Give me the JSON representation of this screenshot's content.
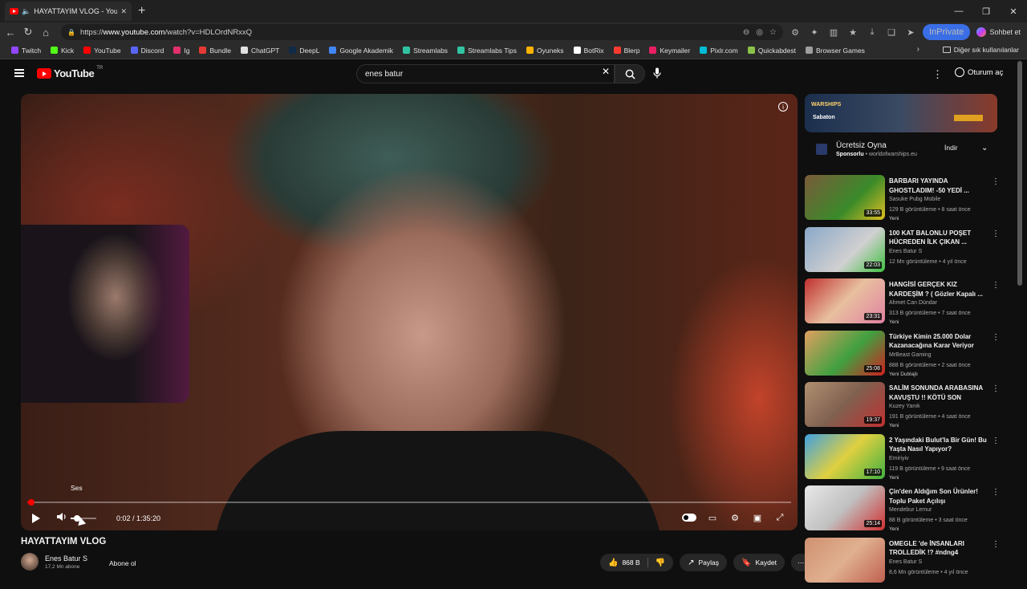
{
  "browser": {
    "tab_title": "HAYATTAYIM VLOG - YouTube",
    "tab_close": "✕",
    "new_tab": "+",
    "url_prefix": "https://",
    "url_host": "www.youtube.com",
    "url_path": "/watch?v=HDLOrdNRxxQ",
    "inprivate": "InPrivate",
    "sohbet": "Sohbet et",
    "window_controls": [
      "—",
      "❐",
      "✕"
    ]
  },
  "bookmarks": {
    "items": [
      {
        "label": "Twitch",
        "color": "#9146ff"
      },
      {
        "label": "Kick",
        "color": "#53fc18"
      },
      {
        "label": "YouTube",
        "color": "#ff0000"
      },
      {
        "label": "Discord",
        "color": "#5865f2"
      },
      {
        "label": "Ig",
        "color": "#e1306c"
      },
      {
        "label": "Bundle",
        "color": "#e53935"
      },
      {
        "label": "ChatGPT",
        "color": "#e0e0e0"
      },
      {
        "label": "DeepL",
        "color": "#0f2b46"
      },
      {
        "label": "Google Akademik",
        "color": "#4285f4"
      },
      {
        "label": "Streamlabs",
        "color": "#31c3a2"
      },
      {
        "label": "Streamlabs Tips",
        "color": "#31c3a2"
      },
      {
        "label": "Oyuneks",
        "color": "#ffb300"
      },
      {
        "label": "BotRix",
        "color": "#ffffff"
      },
      {
        "label": "Blerp",
        "color": "#ff3b30"
      },
      {
        "label": "Keymailer",
        "color": "#e91e63"
      },
      {
        "label": "Pixlr.com",
        "color": "#00bcd4"
      },
      {
        "label": "Quickabdest",
        "color": "#8bc34a"
      },
      {
        "label": "Browser Games",
        "color": "#9e9e9e"
      }
    ],
    "other": "Diğer sık kullanılanlar"
  },
  "youtube": {
    "logo": "YouTube",
    "logo_region": "TR",
    "search_value": "enes batur",
    "signin": "Oturum aç"
  },
  "player": {
    "volume_tooltip": "Ses",
    "time": "0:02 / 1:35:20",
    "progress": 0.001,
    "volume_level": 0.25
  },
  "video": {
    "title": "HAYATTAYIM VLOG",
    "channel": "Enes Batur S",
    "subscribers": "17,2 Mn abone",
    "subscribe": "Abone ol",
    "likes": "868 B",
    "share": "Paylaş",
    "save": "Kaydet"
  },
  "ad": {
    "banner_game": "WARSHIPS",
    "banner_band": "Sabaton",
    "title": "Ücretsiz Oyna",
    "sponsor": "Sponsorlu",
    "domain": "worldofwarships.eu",
    "button": "İndir"
  },
  "recommendations": [
    {
      "title": "BARBARI YAYINDA GHOSTLADIM! -50 YEDİ ...",
      "channel": "Sasuke Pubg Mobile",
      "meta": "129 B görüntüleme • 8 saat önce",
      "badge": "Yeni",
      "duration": "33:55",
      "bg": "linear-gradient(135deg,#7a5a3a,#3a8a2a 60%,#e0c020)"
    },
    {
      "title": "100 KAT BALONLU POŞET HÜCREDEN İLK ÇIKAN ...",
      "channel": "Enes Batur S",
      "meta": "12 Mn görüntüleme • 4 yıl önce",
      "badge": "",
      "duration": "22:03",
      "bg": "linear-gradient(135deg,#8aa8c8,#d0d0d0 60%,#40c040)"
    },
    {
      "title": "HANGİSİ GERÇEK KIZ KARDEŞİM ? ( Gözler Kapalı ...",
      "channel": "Ahmet Can Dündar",
      "meta": "313 B görüntüleme • 7 saat önce",
      "badge": "Yeni",
      "duration": "23:31",
      "bg": "linear-gradient(135deg,#c03030,#e8c0a0 50%,#e080a0)"
    },
    {
      "title": "Türkiye Kimin 25.000 Dolar Kazanacağına Karar Veriyor",
      "channel": "MrBeast Gaming",
      "meta": "888 B görüntüleme • 2 saat önce",
      "badge": "Yeni   Dublajlı",
      "duration": "25:08",
      "bg": "linear-gradient(135deg,#e0a060,#40a040 55%,#d02020)"
    },
    {
      "title": "SALİM SONUNDA ARABASINA KAVUŞTU !! KÖTÜ SON",
      "channel": "Kuzey Yanık",
      "meta": "191 B görüntüleme • 4 saat önce",
      "badge": "Yeni",
      "duration": "19:37",
      "bg": "linear-gradient(135deg,#b09070,#806050 50%,#c03030)"
    },
    {
      "title": "2 Yaşındaki Bulut'la Bir Gün! Bu Yaşta Nasıl Yapıyor?",
      "channel": "Emiriyiv",
      "meta": "119 B görüntüleme • 9 saat önce",
      "badge": "Yeni",
      "duration": "17:10",
      "bg": "linear-gradient(135deg,#40a0e0,#e0d040 50%,#40b040)"
    },
    {
      "title": "Çin'den Aldığım Son Ürünler! Toplu Paket Açılışı",
      "channel": "Mendebur Lemur",
      "meta": "88 B görüntüleme • 3 saat önce",
      "badge": "Yeni",
      "duration": "25:14",
      "bg": "linear-gradient(135deg,#e8e8e8,#c0c0c0 50%,#d03030)"
    },
    {
      "title": "OMEGLE 'de İNSANLARI TROLLEDİK !? #ndng4",
      "channel": "Enes Batur S",
      "meta": "8,6 Mn görüntüleme • 4 yıl önce",
      "badge": "",
      "duration": "",
      "bg": "linear-gradient(135deg,#d09070,#e0b090 50%,#c06050)"
    }
  ]
}
